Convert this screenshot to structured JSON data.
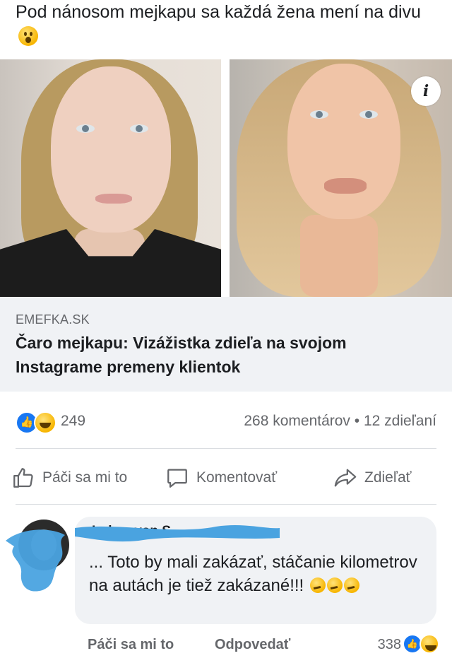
{
  "post": {
    "text": "Pod nánosom mejkapu sa každá žena mení na divu",
    "emoji": "astonished-face"
  },
  "link": {
    "domain": "EMEFKA.SK",
    "title": "Čaro mejkapu: Vizážistka zdieľa na svojom Instagrame premeny klientok",
    "info_label": "i"
  },
  "stats": {
    "reactions": [
      "like",
      "haha"
    ],
    "reaction_count": "249",
    "comments_shares": "268 komentárov • 12 zdieľaní"
  },
  "actions": {
    "like": "Páči sa mi to",
    "comment": "Komentovať",
    "share": "Zdieľať"
  },
  "comment": {
    "author": "Lukas von S...",
    "text": "... Toto by mali zakázať, stáčanie kilometrov na autách je tiež zakázané!!!",
    "emojis": [
      "thinking-face",
      "thinking-face",
      "thinking-face"
    ],
    "like_label": "Páči sa mi to",
    "reply_label": "Odpovedať",
    "reaction_count": "338",
    "reactions": [
      "like",
      "haha"
    ],
    "scribble_color": "#4aa3e0"
  },
  "colors": {
    "facebook_blue": "#1877f2",
    "secondary_text": "#65676b",
    "bubble_bg": "#f0f2f5"
  }
}
